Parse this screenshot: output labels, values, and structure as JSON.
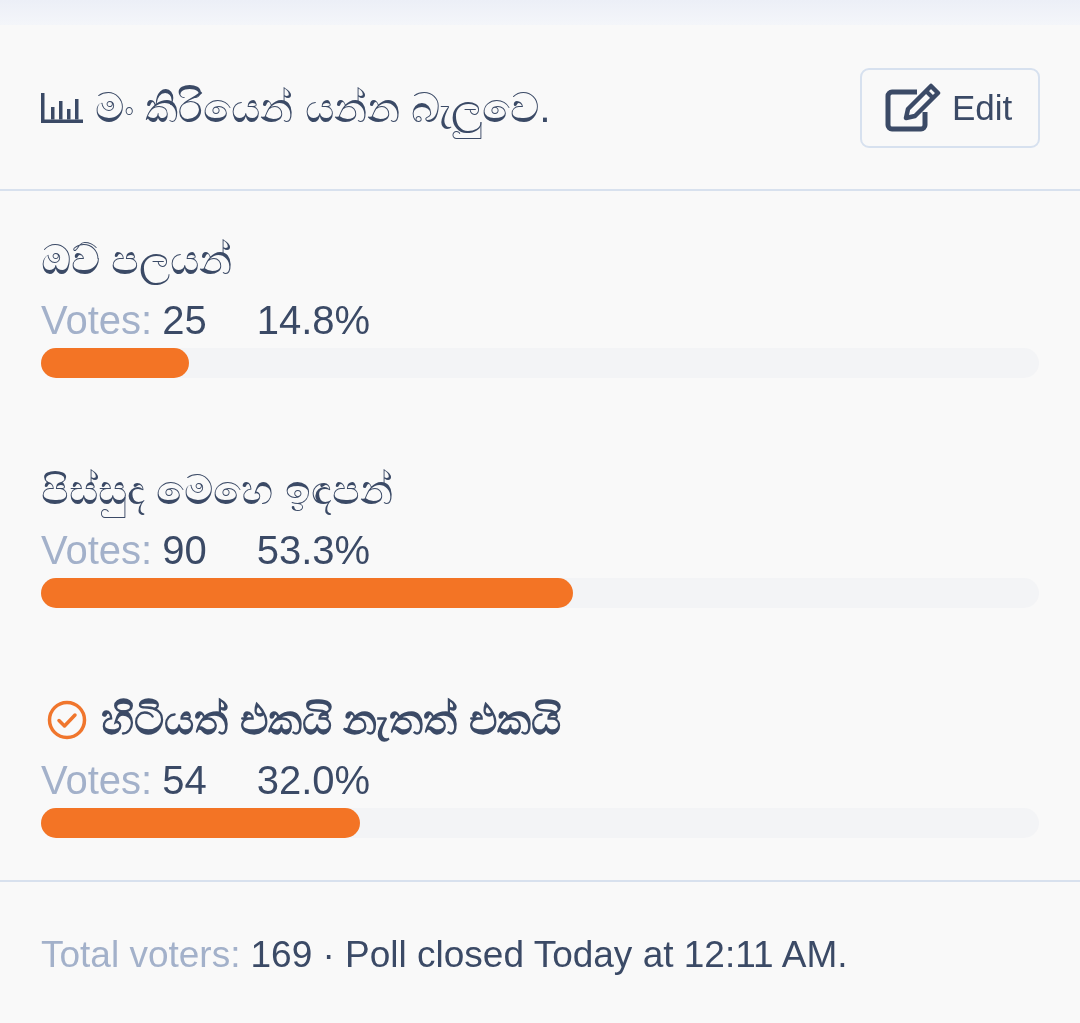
{
  "poll": {
    "title": "මං කිරියෙන් යන්න බැලුවෙ.",
    "edit_button": "Edit"
  },
  "options": [
    {
      "label": "ඔව් පලයන්",
      "votes_label": "Votes:",
      "votes": "25",
      "percent": "14.8%",
      "level": 0.148,
      "selected": false
    },
    {
      "label": "පිස්සුද මෙහෙ ඉඳපන්",
      "votes_label": "Votes:",
      "votes": "90",
      "percent": "53.3%",
      "level": 0.533,
      "selected": false
    },
    {
      "label": "හිටියත් එකයි නැතත් එකයි",
      "votes_label": "Votes:",
      "votes": "54",
      "percent": "32.0%",
      "level": 0.32,
      "selected": true
    }
  ],
  "footer": {
    "total_label": "Total voters:",
    "summary": "169 · Poll closed Today at 12:11 AM."
  }
}
